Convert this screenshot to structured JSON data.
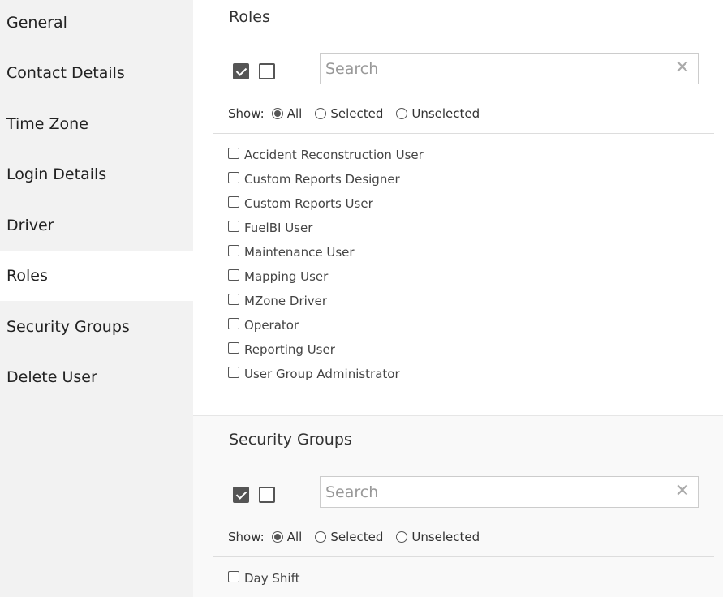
{
  "sidebar": {
    "items": [
      {
        "label": "General"
      },
      {
        "label": "Contact Details"
      },
      {
        "label": "Time Zone"
      },
      {
        "label": "Login Details"
      },
      {
        "label": "Driver"
      },
      {
        "label": "Roles"
      },
      {
        "label": "Security Groups"
      },
      {
        "label": "Delete User"
      }
    ],
    "active": "Roles"
  },
  "roles": {
    "title": "Roles",
    "search_placeholder": "Search",
    "clear_glyph": "✕",
    "show_label": "Show:",
    "filter_options": [
      "All",
      "Selected",
      "Unselected"
    ],
    "selected_filter": "All",
    "items": [
      "Accident Reconstruction User",
      "Custom Reports Designer",
      "Custom Reports User",
      "FuelBI User",
      "Maintenance User",
      "Mapping User",
      "MZone Driver",
      "Operator",
      "Reporting User",
      "User Group Administrator"
    ]
  },
  "security_groups": {
    "title": "Security Groups",
    "search_placeholder": "Search",
    "clear_glyph": "✕",
    "show_label": "Show:",
    "filter_options": [
      "All",
      "Selected",
      "Unselected"
    ],
    "selected_filter": "All",
    "items": [
      "Day Shift"
    ]
  }
}
